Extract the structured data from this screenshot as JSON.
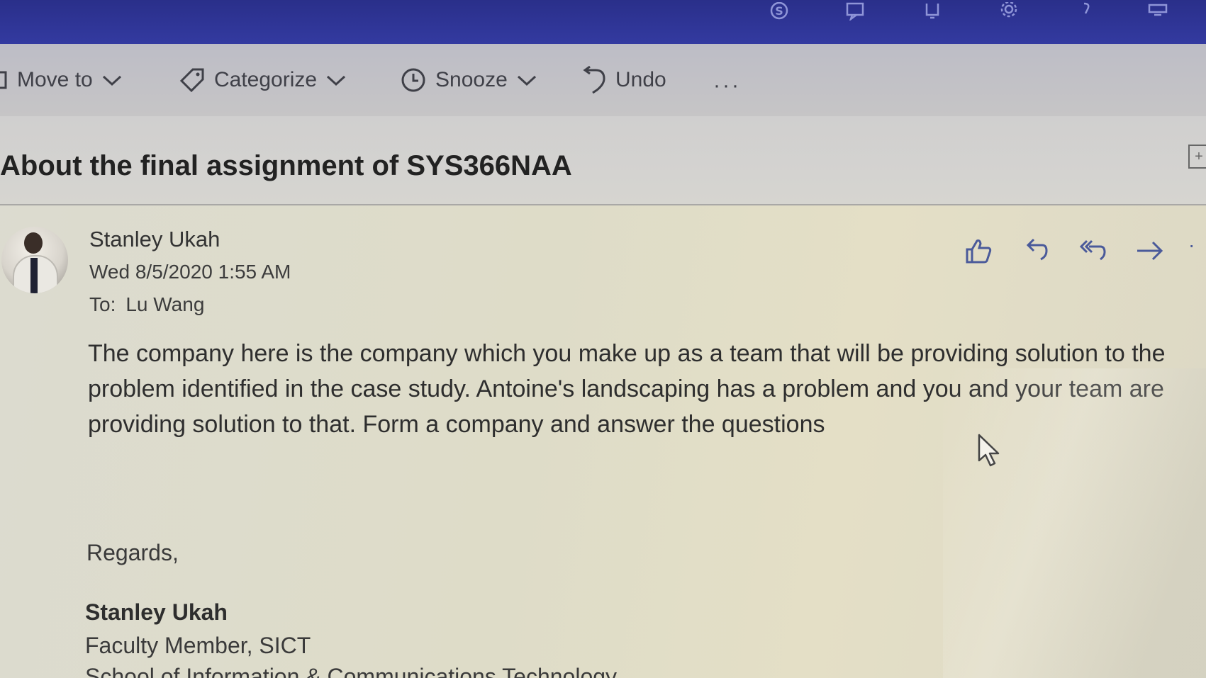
{
  "topbar": {
    "icons": [
      "skype-icon",
      "feedback-icon",
      "notifications-icon",
      "settings-icon",
      "help-icon",
      "my-day-icon"
    ]
  },
  "toolbar": {
    "move_to_label": "Move to",
    "categorize_label": "Categorize",
    "snooze_label": "Snooze",
    "undo_label": "Undo",
    "more_label": "···"
  },
  "message": {
    "subject": "About the final assignment of SYS366NAA",
    "sender": "Stanley Ukah",
    "date": "Wed 8/5/2020 1:55 AM",
    "to_label": "To:",
    "to_name": "Lu Wang",
    "body_lines": [
      "The company here is the company which you make up as a team that will be providing solution to the",
      "problem identified in the case study. Antoine's landscaping has a problem and you and your team are",
      "providing solution to that. Form a company and answer the questions"
    ],
    "regards": "Regards,",
    "signature": {
      "name": "Stanley Ukah",
      "role": "Faculty Member,  SICT",
      "school": "School of Information & Communications Technology"
    },
    "actions": [
      "like-icon",
      "reply-icon",
      "reply-all-icon",
      "forward-icon"
    ],
    "more_actions_label": "·"
  },
  "colors": {
    "appbar": "#2a2f8a",
    "toolbar": "#c2c1c6",
    "action_icon": "#4a5a9a"
  }
}
